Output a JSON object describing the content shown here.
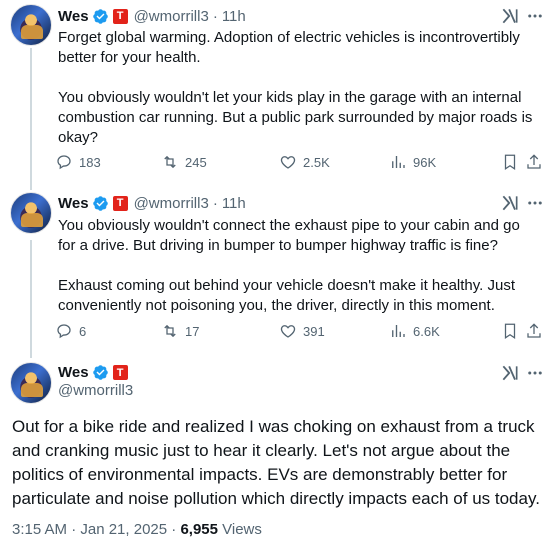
{
  "colors": {
    "verified": "#1d9bf0",
    "affiliate": "#e2231a",
    "muted": "#536471",
    "text": "#0f1419"
  },
  "tweets": [
    {
      "name": "Wes",
      "handle": "@wmorrill3",
      "time": "11h",
      "text": "Forget global warming. Adoption of electric vehicles is incontrovertibly better for your health.\n\nYou obviously wouldn't let your kids play in the garage with an internal combustion car running. But a public park surrounded by major roads is okay?",
      "replies": "183",
      "reposts": "245",
      "likes": "2.5K",
      "views": "96K"
    },
    {
      "name": "Wes",
      "handle": "@wmorrill3",
      "time": "11h",
      "text": "You obviously wouldn't connect the exhaust pipe to your cabin and go for a drive. But driving in bumper to bumper highway traffic is fine?\n\nExhaust coming out behind your vehicle doesn't make it healthy. Just conveniently not poisoning you, the driver, directly in this moment.",
      "replies": "6",
      "reposts": "17",
      "likes": "391",
      "views": "6.6K"
    }
  ],
  "main": {
    "name": "Wes",
    "handle": "@wmorrill3",
    "text": "Out for a bike ride and realized I was choking on exhaust from a truck and cranking music just to hear it clearly. Let's not argue about the politics of environmental impacts. EVs are demonstrably better for particulate and noise pollution which directly impacts each of us today.",
    "timestamp": "3:15 AM · Jan 21, 2025 · ",
    "views_count": "6,955",
    "views_label": " Views"
  },
  "icons": {
    "verified": "verified-badge-icon",
    "affiliate": "affiliate-badge-icon",
    "grok": "grok-icon",
    "more": "more-icon",
    "reply": "reply-icon",
    "repost": "repost-icon",
    "like": "like-icon",
    "views": "views-icon",
    "bookmark": "bookmark-icon",
    "share": "share-icon"
  }
}
